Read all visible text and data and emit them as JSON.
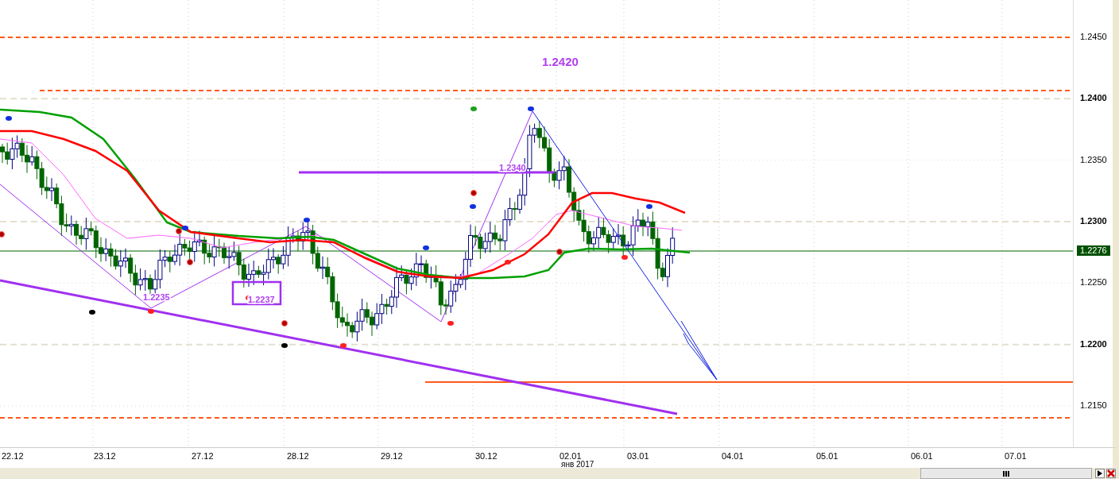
{
  "chart": {
    "annotations": [
      {
        "text": "1.2420",
        "kind": "level"
      },
      {
        "text": "1.2340",
        "kind": "line"
      },
      {
        "text": "1.2235",
        "kind": "plain"
      },
      {
        "text": "1.2237",
        "kind": "boxed"
      }
    ],
    "current_price": "1.2276"
  },
  "price_axis": [
    {
      "label": "1.2450",
      "major": false
    },
    {
      "label": "1.2400",
      "major": true
    },
    {
      "label": "1.2350",
      "major": false
    },
    {
      "label": "1.2300",
      "major": true
    },
    {
      "label": "1.2250",
      "major": false
    },
    {
      "label": "1.2200",
      "major": true
    },
    {
      "label": "1.2150",
      "major": false
    }
  ],
  "date_axis": {
    "labels": [
      "22.12",
      "23.12",
      "27.12",
      "28.12",
      "29.12",
      "30.12",
      "02.01",
      "03.01",
      "04.01",
      "05.01",
      "06.01",
      "07.01"
    ],
    "month": "янв 2017"
  }
}
